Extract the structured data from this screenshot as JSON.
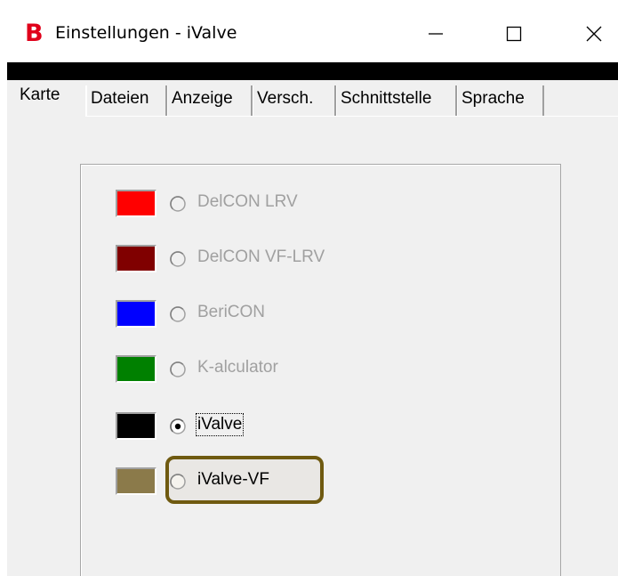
{
  "window": {
    "title": "Einstellungen - iValve",
    "logo_letter": "B",
    "logo_color": "#e0001a"
  },
  "title_controls": {
    "minimize": "minimize-icon",
    "maximize": "maximize-icon",
    "close": "close-icon"
  },
  "tabs": [
    {
      "label": "Karte",
      "active": true
    },
    {
      "label": "Dateien",
      "active": false
    },
    {
      "label": "Anzeige",
      "active": false
    },
    {
      "label": "Versch.",
      "active": false
    },
    {
      "label": "Schnittstelle",
      "active": false
    },
    {
      "label": "Sprache",
      "active": false
    }
  ],
  "options": [
    {
      "label": "DelCON LRV",
      "color": "#ff0000",
      "enabled": false,
      "selected": false
    },
    {
      "label": "DelCON VF-LRV",
      "color": "#800000",
      "enabled": false,
      "selected": false
    },
    {
      "label": "BeriCON",
      "color": "#0000ff",
      "enabled": false,
      "selected": false
    },
    {
      "label": "K-alculator",
      "color": "#008000",
      "enabled": false,
      "selected": false
    },
    {
      "label": "iValve",
      "color": "#000000",
      "enabled": true,
      "selected": true
    },
    {
      "label": "iValve-VF",
      "color": "#8b7a4a",
      "enabled": true,
      "selected": false
    }
  ],
  "highlight_color": "#6f5a10"
}
